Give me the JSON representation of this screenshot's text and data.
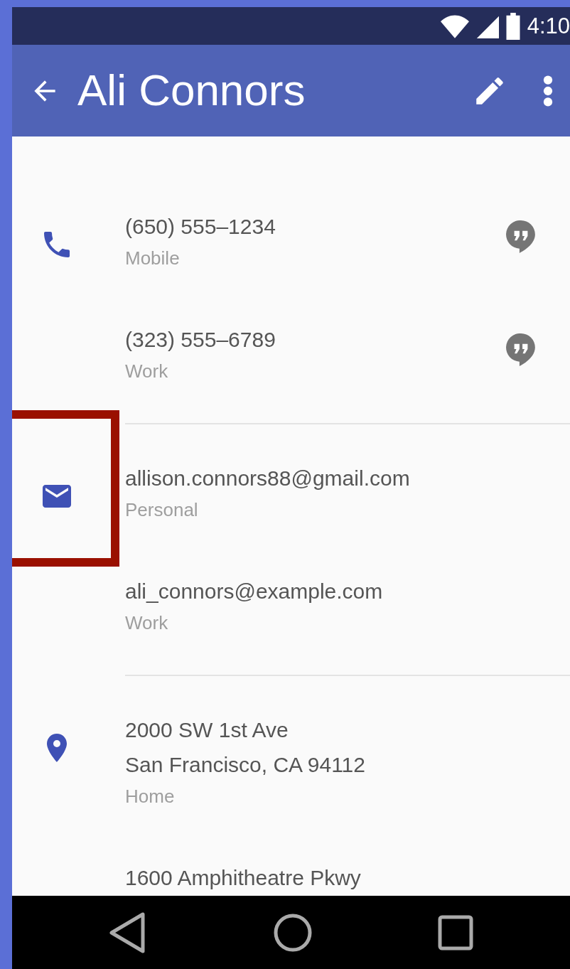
{
  "status_bar": {
    "time": "4:10"
  },
  "app_bar": {
    "title": "Ali Connors"
  },
  "sections": [
    {
      "kind": "phone",
      "highlighted": false,
      "entries": [
        {
          "lines": [
            "(650) 555–1234"
          ],
          "label": "Mobile",
          "chat": true
        },
        {
          "lines": [
            "(323) 555–6789"
          ],
          "label": "Work",
          "chat": true
        }
      ]
    },
    {
      "kind": "email",
      "highlighted": true,
      "entries": [
        {
          "lines": [
            "allison.connors88@gmail.com"
          ],
          "label": "Personal",
          "chat": false
        },
        {
          "lines": [
            "ali_connors@example.com"
          ],
          "label": "Work",
          "chat": false
        }
      ]
    },
    {
      "kind": "place",
      "highlighted": false,
      "entries": [
        {
          "lines": [
            "2000 SW 1st Ave",
            "San Francisco, CA 94112"
          ],
          "label": "Home",
          "chat": false
        },
        {
          "lines": [
            "1600 Amphitheatre Pkwy"
          ],
          "chat": false
        }
      ]
    }
  ]
}
